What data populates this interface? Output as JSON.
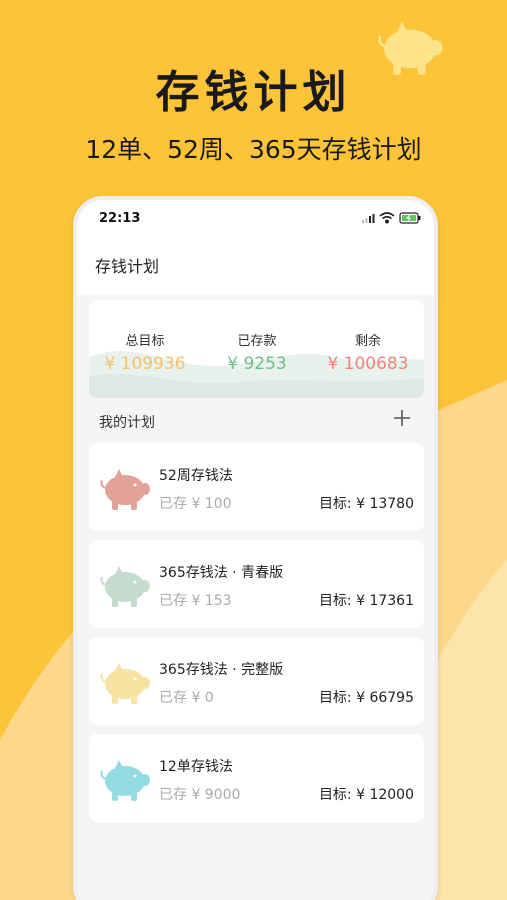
{
  "hero": {
    "title": "存钱计划",
    "subtitle": "12单、52周、365天存钱计划"
  },
  "status_bar": {
    "time": "22:13"
  },
  "nav": {
    "title": "存钱计划"
  },
  "summary": {
    "total_label": "总目标",
    "total_value": "¥ 109936",
    "saved_label": "已存款",
    "saved_value": "¥ 9253",
    "remaining_label": "剩余",
    "remaining_value": "¥ 100683"
  },
  "plans": {
    "title": "我的计划",
    "items": [
      {
        "name": "52周存钱法",
        "saved": "已存 ¥ 100",
        "target": "目标: ¥ 13780"
      },
      {
        "name": "365存钱法 · 青春版",
        "saved": "已存 ¥ 153",
        "target": "目标: ¥ 17361"
      },
      {
        "name": "365存钱法 · 完整版",
        "saved": "已存 ¥ 0",
        "target": "目标: ¥ 66795"
      },
      {
        "name": "12单存钱法",
        "saved": "已存 ¥ 9000",
        "target": "目标: ¥ 12000"
      }
    ]
  },
  "colors": {
    "background": "#fdc43a",
    "total": "#f2c26b",
    "saved": "#6cbf8a",
    "remaining": "#e8877d",
    "pig_52": "#e2a29a",
    "pig_365_youth": "#c4dccf",
    "pig_365_full": "#f6e4a0",
    "pig_12": "#93dde2"
  },
  "icons": [
    "piggy-bank-icon",
    "signal-icon",
    "wifi-icon",
    "battery-icon",
    "plus-icon"
  ]
}
